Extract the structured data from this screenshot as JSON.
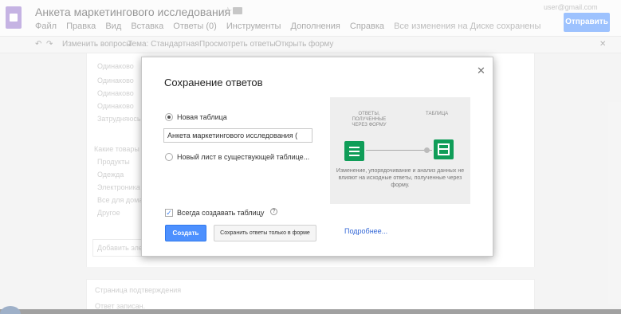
{
  "app": {
    "doc_title": "Анкета маркетингового исследования",
    "menu": [
      "Файл",
      "Правка",
      "Вид",
      "Вставка",
      "Ответы (0)",
      "Инструменты",
      "Дополнения",
      "Справка"
    ],
    "last_edit": "Все изменения на Диске сохранены",
    "account": "user@gmail.com",
    "send_label": "Отправить"
  },
  "toolbar": {
    "edit_questions": "Изменить вопросы",
    "theme": "Тема: Стандартная",
    "view_responses": "Просмотреть ответы",
    "view_form": "Открыть форму"
  },
  "background": {
    "options": [
      "Одинаково",
      "Одинаково",
      "Одинаково",
      "Одинаково",
      "Затрудняюсь"
    ],
    "question2": "Какие товары",
    "options2": [
      "Продукты",
      "Одежда",
      "Электроника",
      "Все для дома",
      "Другое"
    ],
    "bottom_field": "Добавить элемент",
    "confirmation_title": "Страница подтверждения",
    "confirmation_text": "Ответ записан."
  },
  "dialog": {
    "title": "Сохранение ответов",
    "new_sheet_label": "Новая таблица",
    "sheet_name": "Анкета маркетингового исследования (",
    "existing_sheet_label": "Новый лист в существующей таблице...",
    "always_create_label": "Всегда создавать таблицу",
    "create_button": "Создать",
    "later_button": "Сохранить ответы только в форме",
    "learn_more": "Подробнее...",
    "illus_left": "ОТВЕТЫ, ПОЛУЧЕННЫЕ ЧЕРЕЗ ФОРМУ",
    "illus_right": "ТАБЛИЦА",
    "illus_caption": "Изменение, упорядочивание и анализ данных не влияют на исходные ответы, полученные через форму."
  },
  "colors": {
    "accent": "#4d90fe",
    "forms_green": "#0f9d58",
    "link": "#3367d6"
  },
  "icons": {
    "close": "close-icon",
    "help": "help-icon",
    "form": "forms-icon",
    "sheet": "sheets-icon"
  }
}
